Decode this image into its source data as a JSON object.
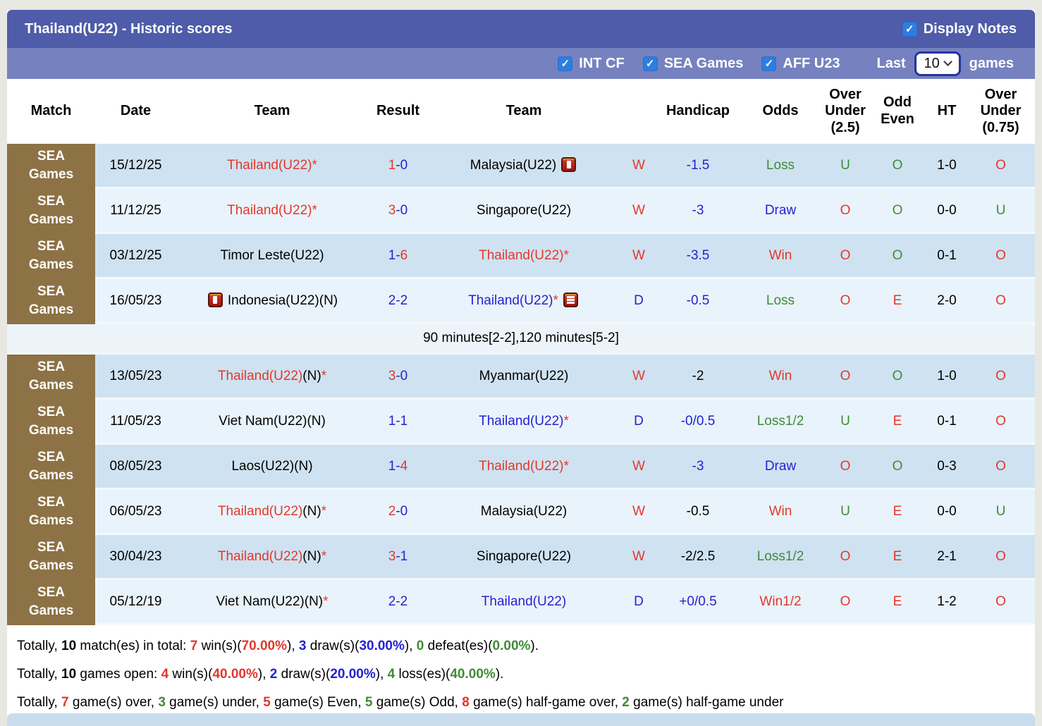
{
  "icons": {
    "check": "✓"
  },
  "header": {
    "title": "Thailand(U22) - Historic scores",
    "display_notes_label": "Display Notes"
  },
  "filters": {
    "checkboxes": [
      {
        "label": "INT CF",
        "checked": true
      },
      {
        "label": "SEA Games",
        "checked": true
      },
      {
        "label": "AFF U23",
        "checked": true
      }
    ],
    "last_label": "Last",
    "games_count": "10",
    "games_label": "games"
  },
  "table": {
    "headers": [
      "Match",
      "Date",
      "Team",
      "Result",
      "Team",
      "",
      "Handicap",
      "Odds",
      "Over Under (2.5)",
      "Odd Even",
      "HT",
      "Over Under (0.75)"
    ],
    "rows": [
      {
        "league": "SEA Games",
        "date": "15/12/25",
        "shade": "dark",
        "home": {
          "seg": [
            [
              "Thailand(U22)*",
              "red"
            ]
          ]
        },
        "result": [
          [
            "1",
            "red"
          ],
          [
            "-0",
            "blue"
          ]
        ],
        "away": {
          "seg": [
            [
              "Malaysia(U22)",
              "black"
            ]
          ],
          "icon_after": "alert"
        },
        "wdl": [
          "W",
          "red"
        ],
        "handicap": [
          "-1.5",
          "blue"
        ],
        "odds": [
          "Loss",
          "green"
        ],
        "ou25": [
          "U",
          "green"
        ],
        "oddeven": [
          "O",
          "green"
        ],
        "ht": "1-0",
        "ou075": [
          "O",
          "red"
        ]
      },
      {
        "league": "SEA Games",
        "date": "11/12/25",
        "shade": "light",
        "home": {
          "seg": [
            [
              "Thailand(U22)*",
              "red"
            ]
          ]
        },
        "result": [
          [
            "3",
            "red"
          ],
          [
            "-0",
            "blue"
          ]
        ],
        "away": {
          "seg": [
            [
              "Singapore(U22)",
              "black"
            ]
          ]
        },
        "wdl": [
          "W",
          "red"
        ],
        "handicap": [
          "-3",
          "blue"
        ],
        "odds": [
          "Draw",
          "blue"
        ],
        "ou25": [
          "O",
          "red"
        ],
        "oddeven": [
          "O",
          "green"
        ],
        "ht": "0-0",
        "ou075": [
          "U",
          "green"
        ]
      },
      {
        "league": "SEA Games",
        "date": "03/12/25",
        "shade": "dark",
        "home": {
          "seg": [
            [
              "Timor Leste(U22)",
              "black"
            ]
          ]
        },
        "result": [
          [
            "1-",
            "blue"
          ],
          [
            "6",
            "red"
          ]
        ],
        "away": {
          "seg": [
            [
              "Thailand(U22)*",
              "red"
            ]
          ]
        },
        "wdl": [
          "W",
          "red"
        ],
        "handicap": [
          "-3.5",
          "blue"
        ],
        "odds": [
          "Win",
          "red"
        ],
        "ou25": [
          "O",
          "red"
        ],
        "oddeven": [
          "O",
          "green"
        ],
        "ht": "0-1",
        "ou075": [
          "O",
          "red"
        ]
      },
      {
        "league": "SEA Games",
        "date": "16/05/23",
        "shade": "light",
        "home": {
          "icon_before": "alert",
          "seg": [
            [
              "Indonesia(U22)(N)",
              "black"
            ]
          ]
        },
        "result": [
          [
            "2-2",
            "blue"
          ]
        ],
        "away": {
          "seg": [
            [
              "Thailand(U22)",
              "blue"
            ],
            [
              "*",
              "red"
            ]
          ],
          "icon_after": "memo"
        },
        "wdl": [
          "D",
          "blue"
        ],
        "handicap": [
          "-0.5",
          "blue"
        ],
        "odds": [
          "Loss",
          "green"
        ],
        "ou25": [
          "O",
          "red"
        ],
        "oddeven": [
          "E",
          "red"
        ],
        "ht": "2-0",
        "ou075": [
          "O",
          "red"
        ],
        "note": "90 minutes[2-2],120 minutes[5-2]"
      },
      {
        "league": "SEA Games",
        "date": "13/05/23",
        "shade": "dark",
        "home": {
          "seg": [
            [
              "Thailand(U22)",
              "red"
            ],
            [
              "(N)",
              "black"
            ],
            [
              "*",
              "red"
            ]
          ]
        },
        "result": [
          [
            "3",
            "red"
          ],
          [
            "-0",
            "blue"
          ]
        ],
        "away": {
          "seg": [
            [
              "Myanmar(U22)",
              "black"
            ]
          ]
        },
        "wdl": [
          "W",
          "red"
        ],
        "handicap": [
          "-2",
          "black"
        ],
        "odds": [
          "Win",
          "red"
        ],
        "ou25": [
          "O",
          "red"
        ],
        "oddeven": [
          "O",
          "green"
        ],
        "ht": "1-0",
        "ou075": [
          "O",
          "red"
        ]
      },
      {
        "league": "SEA Games",
        "date": "11/05/23",
        "shade": "light",
        "home": {
          "seg": [
            [
              "Viet Nam(U22)(N)",
              "black"
            ]
          ]
        },
        "result": [
          [
            "1-1",
            "blue"
          ]
        ],
        "away": {
          "seg": [
            [
              "Thailand(U22)",
              "blue"
            ],
            [
              "*",
              "red"
            ]
          ]
        },
        "wdl": [
          "D",
          "blue"
        ],
        "handicap": [
          "-0/0.5",
          "blue"
        ],
        "odds": [
          "Loss1/2",
          "green"
        ],
        "ou25": [
          "U",
          "green"
        ],
        "oddeven": [
          "E",
          "red"
        ],
        "ht": "0-1",
        "ou075": [
          "O",
          "red"
        ]
      },
      {
        "league": "SEA Games",
        "date": "08/05/23",
        "shade": "dark",
        "home": {
          "seg": [
            [
              "Laos(U22)(N)",
              "black"
            ]
          ]
        },
        "result": [
          [
            "1-",
            "blue"
          ],
          [
            "4",
            "red"
          ]
        ],
        "away": {
          "seg": [
            [
              "Thailand(U22)*",
              "red"
            ]
          ]
        },
        "wdl": [
          "W",
          "red"
        ],
        "handicap": [
          "-3",
          "blue"
        ],
        "odds": [
          "Draw",
          "blue"
        ],
        "ou25": [
          "O",
          "red"
        ],
        "oddeven": [
          "O",
          "green"
        ],
        "ht": "0-3",
        "ou075": [
          "O",
          "red"
        ]
      },
      {
        "league": "SEA Games",
        "date": "06/05/23",
        "shade": "light",
        "home": {
          "seg": [
            [
              "Thailand(U22)",
              "red"
            ],
            [
              "(N)",
              "black"
            ],
            [
              "*",
              "red"
            ]
          ]
        },
        "result": [
          [
            "2",
            "red"
          ],
          [
            "-0",
            "blue"
          ]
        ],
        "away": {
          "seg": [
            [
              "Malaysia(U22)",
              "black"
            ]
          ]
        },
        "wdl": [
          "W",
          "red"
        ],
        "handicap": [
          "-0.5",
          "black"
        ],
        "odds": [
          "Win",
          "red"
        ],
        "ou25": [
          "U",
          "green"
        ],
        "oddeven": [
          "E",
          "red"
        ],
        "ht": "0-0",
        "ou075": [
          "U",
          "green"
        ]
      },
      {
        "league": "SEA Games",
        "date": "30/04/23",
        "shade": "dark",
        "home": {
          "seg": [
            [
              "Thailand(U22)",
              "red"
            ],
            [
              "(N)",
              "black"
            ],
            [
              "*",
              "red"
            ]
          ]
        },
        "result": [
          [
            "3",
            "red"
          ],
          [
            "-1",
            "blue"
          ]
        ],
        "away": {
          "seg": [
            [
              "Singapore(U22)",
              "black"
            ]
          ]
        },
        "wdl": [
          "W",
          "red"
        ],
        "handicap": [
          "-2/2.5",
          "black"
        ],
        "odds": [
          "Loss1/2",
          "green"
        ],
        "ou25": [
          "O",
          "red"
        ],
        "oddeven": [
          "E",
          "red"
        ],
        "ht": "2-1",
        "ou075": [
          "O",
          "red"
        ]
      },
      {
        "league": "SEA Games",
        "date": "05/12/19",
        "shade": "light",
        "home": {
          "seg": [
            [
              "Viet Nam(U22)(N)",
              "black"
            ],
            [
              "*",
              "red"
            ]
          ]
        },
        "result": [
          [
            "2-2",
            "blue"
          ]
        ],
        "away": {
          "seg": [
            [
              "Thailand(U22)",
              "blue"
            ]
          ]
        },
        "wdl": [
          "D",
          "blue"
        ],
        "handicap": [
          "+0/0.5",
          "blue"
        ],
        "odds": [
          "Win1/2",
          "red"
        ],
        "ou25": [
          "O",
          "red"
        ],
        "oddeven": [
          "E",
          "red"
        ],
        "ht": "1-2",
        "ou075": [
          "O",
          "red"
        ]
      }
    ]
  },
  "summary": {
    "line1": [
      [
        "Totally, ",
        "black"
      ],
      [
        "10",
        "blackb"
      ],
      [
        " match(es) in total: ",
        "black"
      ],
      [
        "7",
        "redb"
      ],
      [
        " win(s)(",
        "black"
      ],
      [
        "70.00%",
        "redb"
      ],
      [
        "), ",
        "black"
      ],
      [
        "3",
        "blueb"
      ],
      [
        " draw(s)(",
        "black"
      ],
      [
        "30.00%",
        "blueb"
      ],
      [
        "), ",
        "black"
      ],
      [
        "0",
        "greenb"
      ],
      [
        " defeat(es)(",
        "black"
      ],
      [
        "0.00%",
        "greenb"
      ],
      [
        ").",
        "black"
      ]
    ],
    "line2": [
      [
        "Totally, ",
        "black"
      ],
      [
        "10",
        "blackb"
      ],
      [
        " games open: ",
        "black"
      ],
      [
        "4",
        "redb"
      ],
      [
        " win(s)(",
        "black"
      ],
      [
        "40.00%",
        "redb"
      ],
      [
        "), ",
        "black"
      ],
      [
        "2",
        "blueb"
      ],
      [
        " draw(s)(",
        "black"
      ],
      [
        "20.00%",
        "blueb"
      ],
      [
        "), ",
        "black"
      ],
      [
        "4",
        "greenb"
      ],
      [
        " loss(es)(",
        "black"
      ],
      [
        "40.00%",
        "greenb"
      ],
      [
        ").",
        "black"
      ]
    ],
    "line3": [
      [
        "Totally, ",
        "black"
      ],
      [
        "7",
        "redb"
      ],
      [
        " game(s) over, ",
        "black"
      ],
      [
        "3",
        "greenb"
      ],
      [
        " game(s) under, ",
        "black"
      ],
      [
        "5",
        "redb"
      ],
      [
        " game(s) Even, ",
        "black"
      ],
      [
        "5",
        "greenb"
      ],
      [
        " game(s) Odd, ",
        "black"
      ],
      [
        "8",
        "redb"
      ],
      [
        " game(s) half-game over, ",
        "black"
      ],
      [
        "2",
        "greenb"
      ],
      [
        " game(s) half-game under",
        "black"
      ]
    ]
  }
}
